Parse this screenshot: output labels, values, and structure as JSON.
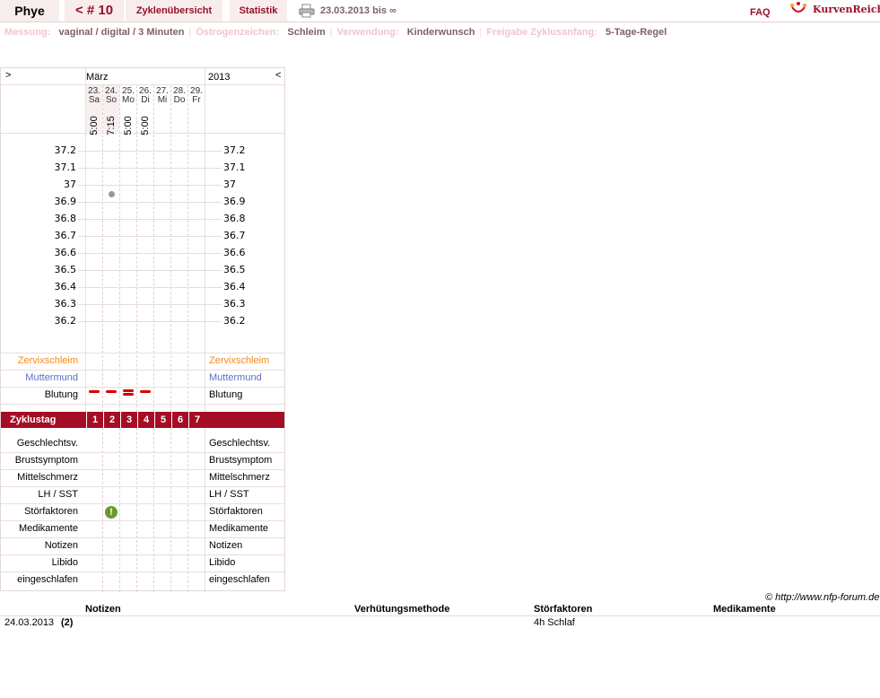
{
  "nav": {
    "name": "Phye",
    "cycle": "< # 10",
    "overview": "Zyklenübersicht",
    "statistics": "Statistik",
    "date_range": "23.03.2013 bis ∞",
    "faq": "FAQ",
    "logo": "KurvenReich"
  },
  "settings": [
    {
      "label": "Messung:",
      "value": "vaginal / digital / 3 Minuten"
    },
    {
      "label": "Östrogenzeichen:",
      "value": "Schleim"
    },
    {
      "label": "Verwendung:",
      "value": "Kinderwunsch"
    },
    {
      "label": "Freigabe Zyklusanfang:",
      "value": "5-Tage-Regel"
    }
  ],
  "chart": {
    "nav_next": ">",
    "nav_prev": "<",
    "month": "März",
    "year": "2013",
    "days": [
      {
        "date": "23.",
        "wd": "Sa",
        "time": "5:00",
        "weekend": true
      },
      {
        "date": "24.",
        "wd": "So",
        "time": "7:15",
        "weekend": true
      },
      {
        "date": "25.",
        "wd": "Mo",
        "time": "5:00",
        "weekend": false
      },
      {
        "date": "26.",
        "wd": "Di",
        "time": "5:00",
        "weekend": false
      },
      {
        "date": "27.",
        "wd": "Mi",
        "time": "",
        "weekend": false
      },
      {
        "date": "28.",
        "wd": "Do",
        "time": "",
        "weekend": false
      },
      {
        "date": "29.",
        "wd": "Fr",
        "time": "",
        "weekend": false
      }
    ],
    "temperatures": [
      "37.2",
      "37.1",
      "37",
      "36.9",
      "36.8",
      "36.7",
      "36.6",
      "36.5",
      "36.4",
      "36.3",
      "36.2"
    ],
    "readings": [
      {
        "day": 2,
        "temp": 36.95
      }
    ],
    "rows_top": [
      {
        "label": "Zervixschleim",
        "color": "#f08a1c"
      },
      {
        "label": "Muttermund",
        "color": "#5a6fc7"
      },
      {
        "label": "Blutung",
        "color": "#000000"
      }
    ],
    "bleeding": [
      1,
      1,
      2,
      1,
      0,
      0,
      0
    ],
    "cycle_label": "Zyklustag",
    "cycle_days": [
      "1",
      "2",
      "3",
      "4",
      "5",
      "6",
      "7"
    ],
    "rows_bottom": [
      "Geschlechtsv.",
      "Brustsymptom",
      "Mittelschmerz",
      "LH / SST",
      "Störfaktoren",
      "Medikamente",
      "Notizen",
      "Libido",
      "eingeschlafen"
    ],
    "disturbance_day": 2
  },
  "footer": {
    "copyright": "© http://www.nfp-forum.de",
    "headers": [
      "Notizen",
      "Verhütungsmethode",
      "Störfaktoren",
      "Medikamente"
    ],
    "rows": [
      {
        "date": "24.03.2013",
        "count": "(2)",
        "disturbance": "4h Schlaf"
      }
    ]
  }
}
